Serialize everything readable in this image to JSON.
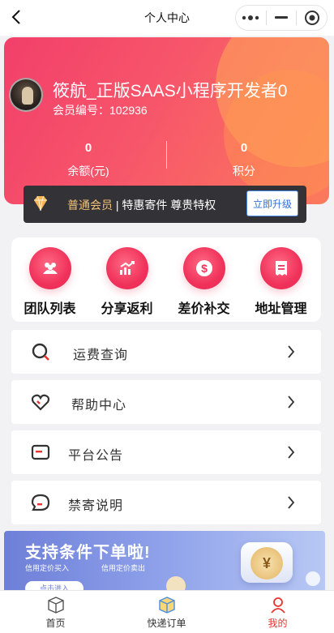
{
  "navbar": {
    "title": "个人中心",
    "back_icon": "chevron-left-icon",
    "capsule_icons": [
      "more-dots-icon",
      "minimize-icon",
      "target-icon"
    ]
  },
  "profile": {
    "username": "筱航_正版SAAS小程序开发者0",
    "member_no_label": "会员编号：",
    "member_no": "102936",
    "balance_value": "0",
    "balance_label": "余额(元)",
    "points_value": "0",
    "points_label": "积分"
  },
  "membership": {
    "icon": "diamond-icon",
    "level": "普通会员",
    "separator": " | ",
    "perk": "特惠寄件 尊贵特权",
    "upgrade_label": "立即升级"
  },
  "grid": [
    {
      "label": "团队列表",
      "icon": "team-icon"
    },
    {
      "label": "分享返利",
      "icon": "share-rebate-icon"
    },
    {
      "label": "差价补交",
      "icon": "dollar-coin-icon"
    },
    {
      "label": "地址管理",
      "icon": "address-book-icon"
    }
  ],
  "menu": [
    {
      "label": "运费查询",
      "icon": "search-icon"
    },
    {
      "label": "帮助中心",
      "icon": "heart-icon"
    },
    {
      "label": "平台公告",
      "icon": "notice-icon"
    },
    {
      "label": "禁寄说明",
      "icon": "chat-bubble-icon"
    }
  ],
  "banner": {
    "title": "支持条件下单啦!",
    "sub1": "信用定价买入",
    "sub2": "信用定价卖出",
    "pill": "点击进入",
    "coin": "¥"
  },
  "tabbar": [
    {
      "label": "首页",
      "icon": "box-icon",
      "active": false
    },
    {
      "label": "快递订单",
      "icon": "package-icon",
      "active": false
    },
    {
      "label": "我的",
      "icon": "user-icon",
      "active": true
    }
  ],
  "colors": {
    "accent_red": "#f23f6a",
    "gold": "#f2c27a",
    "upgrade_blue": "#2f6fe0",
    "active_tab": "#e8342f"
  }
}
